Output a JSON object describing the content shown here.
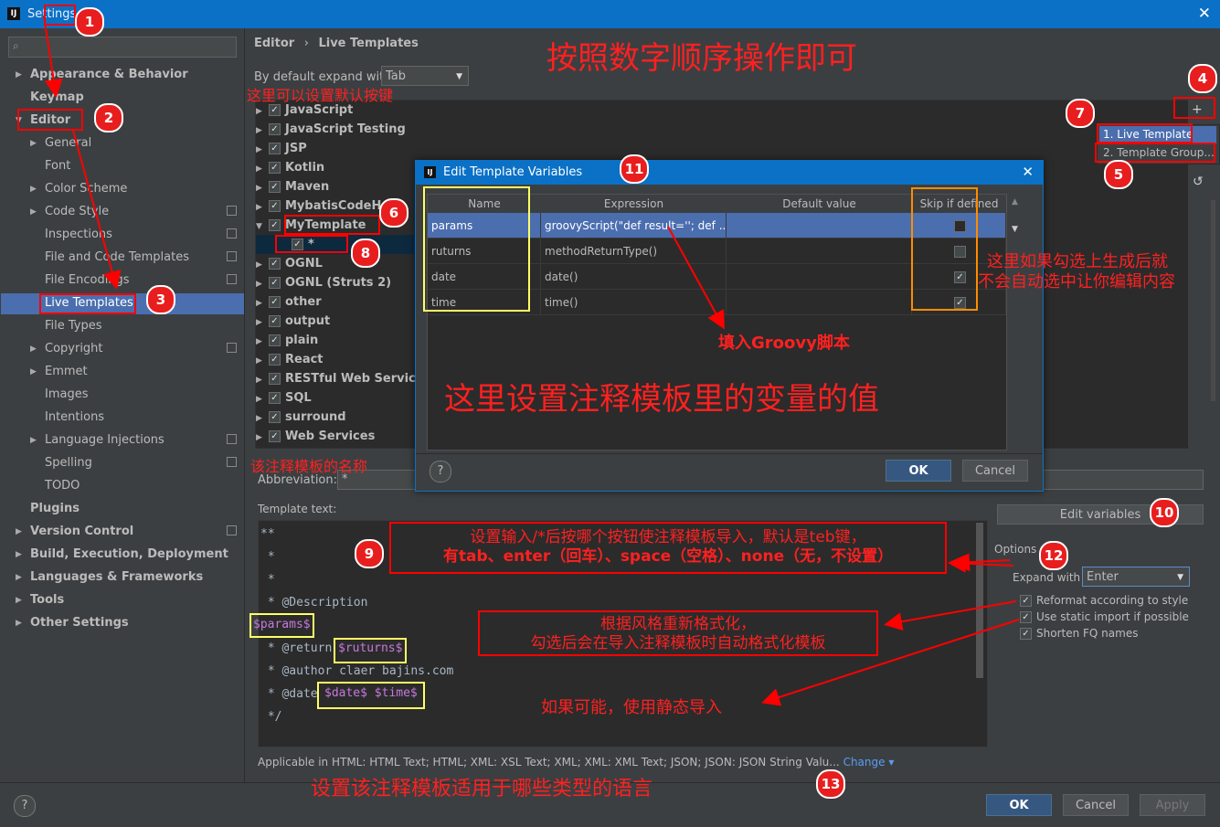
{
  "window": {
    "title": "Settings"
  },
  "search": {
    "placeholder": ""
  },
  "sidebar": {
    "items": [
      {
        "label": "Appearance & Behavior"
      },
      {
        "label": "Keymap"
      },
      {
        "label": "Editor"
      },
      {
        "label": "General"
      },
      {
        "label": "Font"
      },
      {
        "label": "Color Scheme"
      },
      {
        "label": "Code Style"
      },
      {
        "label": "Inspections"
      },
      {
        "label": "File and Code Templates"
      },
      {
        "label": "File Encodings"
      },
      {
        "label": "Live Templates"
      },
      {
        "label": "File Types"
      },
      {
        "label": "Copyright"
      },
      {
        "label": "Emmet"
      },
      {
        "label": "Images"
      },
      {
        "label": "Intentions"
      },
      {
        "label": "Language Injections"
      },
      {
        "label": "Spelling"
      },
      {
        "label": "TODO"
      },
      {
        "label": "Plugins"
      },
      {
        "label": "Version Control"
      },
      {
        "label": "Build, Execution, Deployment"
      },
      {
        "label": "Languages & Frameworks"
      },
      {
        "label": "Tools"
      },
      {
        "label": "Other Settings"
      }
    ]
  },
  "breadcrumb": {
    "parent": "Editor",
    "sep": "›",
    "current": "Live Templates"
  },
  "expand": {
    "label": "By default expand with",
    "value": "Tab"
  },
  "templates": {
    "groups": [
      {
        "label": "JavaScript"
      },
      {
        "label": "JavaScript Testing"
      },
      {
        "label": "JSP"
      },
      {
        "label": "Kotlin"
      },
      {
        "label": "Maven"
      },
      {
        "label": "MybatisCodeHel"
      },
      {
        "label": "MyTemplate"
      },
      {
        "label": "*"
      },
      {
        "label": "OGNL"
      },
      {
        "label": "OGNL (Struts 2)"
      },
      {
        "label": "other"
      },
      {
        "label": "output"
      },
      {
        "label": "plain"
      },
      {
        "label": "React"
      },
      {
        "label": "RESTful Web Services"
      },
      {
        "label": "SQL"
      },
      {
        "label": "surround"
      },
      {
        "label": "Web Services"
      }
    ]
  },
  "add_menu": {
    "item1": "1. Live Template",
    "item2": "2. Template Group..."
  },
  "abbreviation": {
    "label": "Abbreviation:",
    "value": "*"
  },
  "template_text": {
    "label": "Template text:",
    "lines": [
      "**",
      " *",
      " *",
      " * @Description",
      "$params$",
      " * @return",
      " * @author claer bajins.com",
      " * @date",
      " */"
    ],
    "return_var": "$ruturns$",
    "date_vars": "$date$ $time$"
  },
  "applicable": {
    "text": "Applicable in HTML: HTML Text; HTML; XML: XSL Text; XML; XML: XML Text; JSON; JSON: JSON String Valu...",
    "change": "Change"
  },
  "edit_variables": {
    "label": "Edit variables"
  },
  "options": {
    "label": "Options",
    "expand_with_label": "Expand with",
    "expand_with_value": "Enter",
    "reformat": "Reformat according to style",
    "static_import": "Use static import if possible",
    "shorten_fq": "Shorten FQ names"
  },
  "buttons": {
    "ok": "OK",
    "cancel": "Cancel",
    "apply": "Apply",
    "help": "?"
  },
  "dialog": {
    "title": "Edit Template Variables",
    "columns": [
      "Name",
      "Expression",
      "Default value",
      "Skip if defined"
    ],
    "rows": [
      {
        "name": "params",
        "expression": "groovyScript(\"def result=''; def ...",
        "default": "",
        "skip": false
      },
      {
        "name": "ruturns",
        "expression": "methodReturnType()",
        "default": "",
        "skip": false
      },
      {
        "name": "date",
        "expression": "date()",
        "default": "",
        "skip": true
      },
      {
        "name": "time",
        "expression": "time()",
        "default": "",
        "skip": true
      }
    ],
    "ok": "OK",
    "cancel": "Cancel",
    "help": "?"
  },
  "annotations": {
    "headline": "按照数字顺序操作即可",
    "default_key_hint": "这里可以设置默认按键",
    "template_name_hint": "该注释模板的名称",
    "groovy_hint": "填入Groovy脚本",
    "variables_hint": "这里设置注释模板里的变量的值",
    "skip_hint_1": "这里如果勾选上生成后就",
    "skip_hint_2": "不会自动选中让你编辑内容",
    "expand_hint_1": "设置输入/*后按哪个按钮使注释模板导入，默认是teb键，",
    "expand_hint_2": "有tab、enter（回车）、space（空格）、none（无，不设置）",
    "reformat_hint_1": "根据风格重新格式化，",
    "reformat_hint_2": "勾选后会在导入注释模板时自动格式化模板",
    "static_hint": "如果可能，使用静态导入",
    "language_hint": "设置该注释模板适用于哪些类型的语言",
    "badges": [
      "1",
      "2",
      "3",
      "4",
      "5",
      "6",
      "7",
      "8",
      "9",
      "10",
      "11",
      "12",
      "13"
    ]
  }
}
